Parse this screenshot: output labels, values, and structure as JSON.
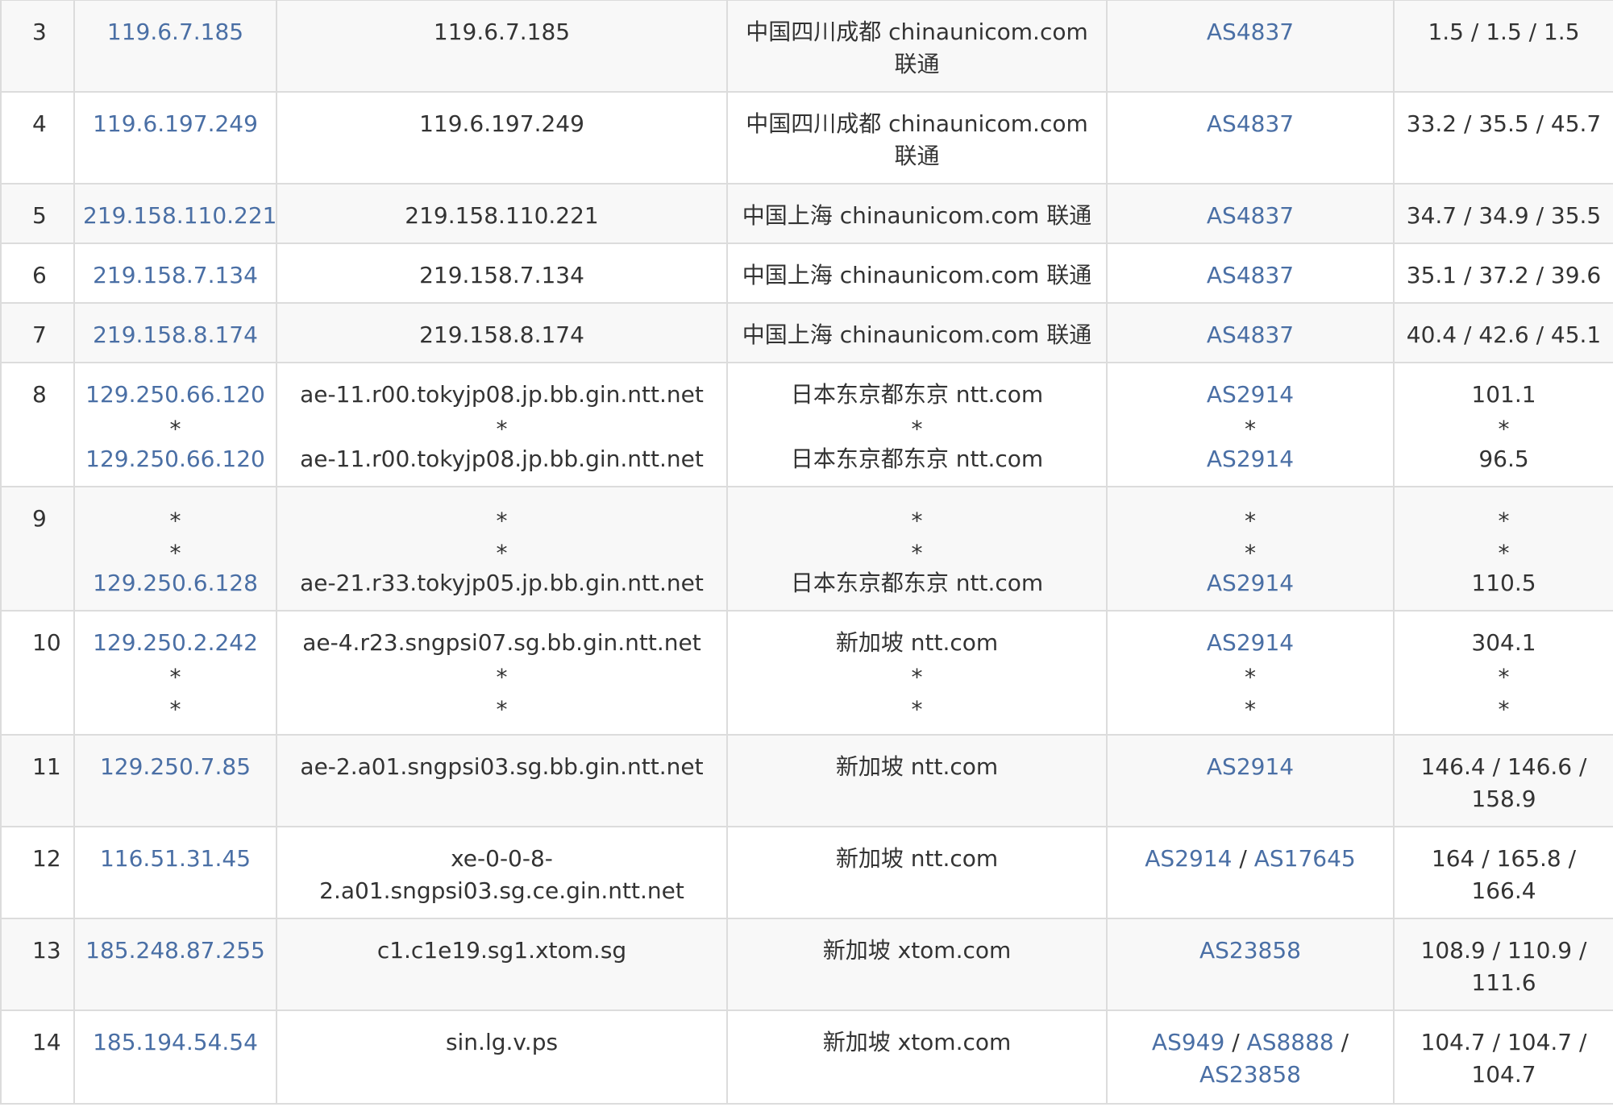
{
  "traceroute": {
    "rows": [
      {
        "hop": "3",
        "ip": "119.6.7.185",
        "host": [
          "119.6.7.185"
        ],
        "location": [
          "中国四川成都 chinaunicom.com",
          "联通"
        ],
        "asn": [
          [
            "AS4837"
          ]
        ],
        "rtt": [
          "1.5 / 1.5 / 1.5"
        ],
        "kind": "tall"
      },
      {
        "hop": "4",
        "ip": "119.6.197.249",
        "host": [
          "119.6.197.249"
        ],
        "location": [
          "中国四川成都 chinaunicom.com",
          "联通"
        ],
        "asn": [
          [
            "AS4837"
          ]
        ],
        "rtt": [
          "33.2 / 35.5 / 45.7"
        ],
        "kind": "tall"
      },
      {
        "hop": "5",
        "ip": "219.158.110.221",
        "host": [
          "219.158.110.221"
        ],
        "location": [
          "中国上海 chinaunicom.com 联通"
        ],
        "asn": [
          [
            "AS4837"
          ]
        ],
        "rtt": [
          "34.7 / 34.9 / 35.5"
        ],
        "kind": "short"
      },
      {
        "hop": "6",
        "ip": "219.158.7.134",
        "host": [
          "219.158.7.134"
        ],
        "location": [
          "中国上海 chinaunicom.com 联通"
        ],
        "asn": [
          [
            "AS4837"
          ]
        ],
        "rtt": [
          "35.1 / 37.2 / 39.6"
        ],
        "kind": "short"
      },
      {
        "hop": "7",
        "ip": "219.158.8.174",
        "host": [
          "219.158.8.174"
        ],
        "location": [
          "中国上海 chinaunicom.com 联通"
        ],
        "asn": [
          [
            "AS4837"
          ]
        ],
        "rtt": [
          "40.4 / 42.6 / 45.1"
        ],
        "kind": "short"
      }
    ],
    "multi_rows": [
      {
        "hop": "8",
        "ips": [
          "129.250.66.120",
          "*",
          "129.250.66.120"
        ],
        "hosts": [
          "ae-11.r00.tokyjp08.jp.bb.gin.ntt.net",
          "*",
          "ae-11.r00.tokyjp08.jp.bb.gin.ntt.net"
        ],
        "locations": [
          "日本东京都东京 ntt.com",
          "*",
          "日本东京都东京 ntt.com"
        ],
        "asns": [
          "AS2914",
          "*",
          "AS2914"
        ],
        "rtts": [
          "101.1",
          "*",
          "96.5"
        ]
      },
      {
        "hop": "9",
        "ips": [
          "*",
          "*",
          "129.250.6.128"
        ],
        "hosts": [
          "*",
          "*",
          "ae-21.r33.tokyjp05.jp.bb.gin.ntt.net"
        ],
        "locations": [
          "*",
          "*",
          "日本东京都东京 ntt.com"
        ],
        "asns": [
          "*",
          "*",
          "AS2914"
        ],
        "rtts": [
          "*",
          "*",
          "110.5"
        ]
      },
      {
        "hop": "10",
        "ips": [
          "129.250.2.242",
          "*",
          "*"
        ],
        "hosts": [
          "ae-4.r23.sngpsi07.sg.bb.gin.ntt.net",
          "*",
          "*"
        ],
        "locations": [
          "新加坡 ntt.com",
          "*",
          "*"
        ],
        "asns": [
          "AS2914",
          "*",
          "*"
        ],
        "rtts": [
          "304.1",
          "*",
          "*"
        ]
      }
    ],
    "tail_rows": [
      {
        "hop": "11",
        "ip": "129.250.7.85",
        "host": [
          "ae-2.a01.sngpsi03.sg.bb.gin.ntt.net"
        ],
        "location": [
          "新加坡 ntt.com"
        ],
        "asn": [
          "AS2914"
        ],
        "rtt": [
          "146.4 / 146.6 /",
          "158.9"
        ]
      },
      {
        "hop": "12",
        "ip": "116.51.31.45",
        "host": [
          "xe-0-0-8-",
          "2.a01.sngpsi03.sg.ce.gin.ntt.net"
        ],
        "location": [
          "新加坡 ntt.com"
        ],
        "asn": [
          "AS2914",
          "AS17645"
        ],
        "rtt": [
          "164 / 165.8 /",
          "166.4"
        ]
      },
      {
        "hop": "13",
        "ip": "185.248.87.255",
        "host": [
          "c1.c1e19.sg1.xtom.sg"
        ],
        "location": [
          "新加坡 xtom.com"
        ],
        "asn": [
          "AS23858"
        ],
        "rtt": [
          "108.9 / 110.9 /",
          "111.6"
        ]
      },
      {
        "hop": "14",
        "ip": "185.194.54.54",
        "host": [
          "sin.lg.v.ps"
        ],
        "location": [
          "新加坡 xtom.com"
        ],
        "asn": [
          "AS949",
          "AS8888",
          "AS23858"
        ],
        "rtt": [
          "104.7 / 104.7 /",
          "104.7"
        ]
      }
    ],
    "separator": "/",
    "colors": {
      "link": "#4a6fa5",
      "text": "#333333",
      "border": "#dcdcdc",
      "stripe": "#f8f8f8"
    }
  }
}
